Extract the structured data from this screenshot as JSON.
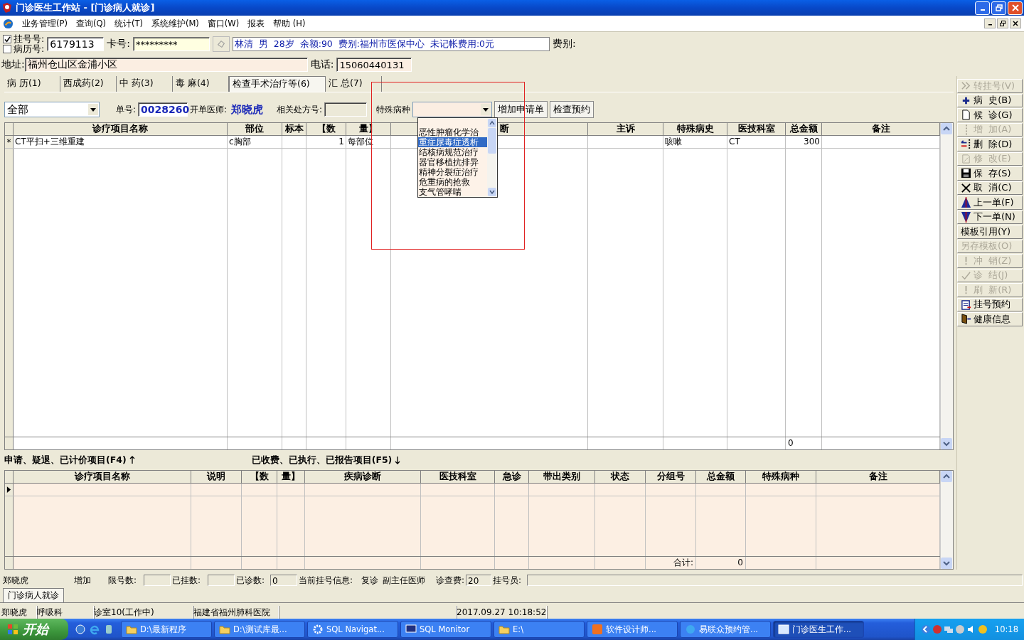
{
  "window": {
    "title": "门诊医生工作站 - [门诊病人就诊]"
  },
  "menu": [
    {
      "label": "业务管理(P)"
    },
    {
      "label": "查询(Q)"
    },
    {
      "label": "统计(T)"
    },
    {
      "label": "系统维护(M)"
    },
    {
      "label": "窗口(W)"
    },
    {
      "label": "报表"
    },
    {
      "label": "帮助 (H)"
    }
  ],
  "patient": {
    "id_options": [
      {
        "label": "挂号号:",
        "checked": true
      },
      {
        "label": "病历号:",
        "checked": false
      }
    ],
    "id_value": "6179113",
    "card_label": "卡号:",
    "card_value": "*********",
    "info": "林清  男  28岁  余额:90  费别:福州市医保中心  未记帐费用:0元",
    "fee_label": "费别:",
    "address_label": "地址:",
    "address_value": "福州仓山区金浦小区",
    "phone_label": "电话:",
    "phone_value": "15060440131"
  },
  "tabs": [
    {
      "label": "病 历(1)",
      "selected": false
    },
    {
      "label": "西成药(2)",
      "selected": false
    },
    {
      "label": "中 药(3)",
      "selected": false
    },
    {
      "label": "毒 麻(4)",
      "selected": false
    },
    {
      "label": "检查手术治疗等(6)",
      "selected": true
    },
    {
      "label": "汇 总(7)",
      "selected": false
    }
  ],
  "toolbar": {
    "filter_value": "全部",
    "order_label": "单号:",
    "order_value": "0028260",
    "doctor_label": "开单医师:",
    "doctor_value": "郑晓虎",
    "related_label": "相关处方号:",
    "disease_label": "特殊病种",
    "buttons": [
      {
        "label": "增加申请单"
      },
      {
        "label": "检查预约"
      }
    ]
  },
  "disease_dropdown": {
    "options": [
      {
        "label": "恶性肿瘤化学治",
        "selected": false
      },
      {
        "label": "重症尿毒症透析",
        "selected": true
      },
      {
        "label": "结核病规范治疗",
        "selected": false
      },
      {
        "label": "器官移植抗排异",
        "selected": false
      },
      {
        "label": "精神分裂症治疗",
        "selected": false
      },
      {
        "label": "危重病的抢救",
        "selected": false
      },
      {
        "label": "支气管哮喘",
        "selected": false
      }
    ]
  },
  "items_grid": {
    "columns": [
      "诊疗项目名称",
      "部位",
      "标本",
      "【数",
      "量】",
      "断",
      "主诉",
      "特殊病史",
      "医技科室",
      "总金额",
      "备注"
    ],
    "rows": [
      {
        "marker": "*",
        "name": "CT平扫+三维重建",
        "site": "c胸部",
        "quantity": "1",
        "unit": "每部位",
        "history": "咳嗽",
        "department": "CT",
        "amount": "300"
      }
    ],
    "footer_total": "0"
  },
  "bottom": {
    "left_label": "申请、疑退、已计价项目(F4)",
    "right_label": "已收费、已执行、已报告项目(F5)",
    "columns": [
      "诊疗项目名称",
      "说明",
      "【数",
      "量】",
      "疾病诊断",
      "医技科室",
      "急诊",
      "带出类别",
      "状态",
      "分组号",
      "总金额",
      "特殊病种",
      "备注"
    ],
    "rows": [
      {
        "current": true
      }
    ],
    "sum_label": "合计:",
    "sum_value": "0"
  },
  "side_buttons": [
    {
      "label": "转挂号(V)",
      "kind": "chevrons",
      "disabled": true
    },
    {
      "label": "病  史(B)",
      "kind": "plus",
      "disabled": false
    },
    {
      "label": "候  诊(G)",
      "kind": "page",
      "disabled": false
    },
    {
      "label": "增  加(A)",
      "kind": "dots",
      "disabled": true
    },
    {
      "label": "删  除(D)",
      "kind": "arrow-left",
      "disabled": false
    },
    {
      "label": "修  改(E)",
      "kind": "edit",
      "disabled": true
    },
    {
      "label": "保  存(S)",
      "kind": "floppy",
      "disabled": false
    },
    {
      "label": "取  消(C)",
      "kind": "cross",
      "disabled": false
    },
    {
      "label": "上一单(F)",
      "kind": "up",
      "disabled": false
    },
    {
      "label": "下一单(N)",
      "kind": "down",
      "disabled": false
    },
    {
      "label": "模板引用(Y)",
      "kind": "none",
      "disabled": false
    },
    {
      "label": "另存模板(O)",
      "kind": "none",
      "disabled": true
    },
    {
      "label": "冲  销(Z)",
      "kind": "exclaim",
      "disabled": true
    },
    {
      "label": "诊  结(J)",
      "kind": "check",
      "disabled": true
    },
    {
      "label": "刷  新(R)",
      "kind": "exclaim",
      "disabled": true
    },
    {
      "label": "挂号预约",
      "kind": "clipboard",
      "disabled": false
    },
    {
      "label": "健康信息",
      "kind": "door",
      "disabled": false
    }
  ],
  "status_bar": [
    {
      "kind": "text",
      "text": "郑晓虎"
    },
    {
      "kind": "text",
      "text": "增加"
    },
    {
      "kind": "text",
      "text": "限号数:"
    },
    {
      "kind": "blank"
    },
    {
      "kind": "text",
      "text": "已挂数:"
    },
    {
      "kind": "blank"
    },
    {
      "kind": "text",
      "text": "已诊数:"
    },
    {
      "kind": "value",
      "text": "0"
    },
    {
      "kind": "text",
      "text": "当前挂号信息:"
    },
    {
      "kind": "text",
      "text": "复诊"
    },
    {
      "kind": "text",
      "text": "副主任医师"
    },
    {
      "kind": "text",
      "text": "诊查费:"
    },
    {
      "kind": "value",
      "text": "20"
    },
    {
      "kind": "text",
      "text": "挂号员:"
    },
    {
      "kind": "blank"
    }
  ],
  "document_tabs": [
    {
      "label": "门诊病人就诊",
      "selected": true
    }
  ],
  "info_bar": [
    {
      "text": "郑晓虎"
    },
    {
      "text": "呼吸科"
    },
    {
      "text": "诊室10(工作中)"
    },
    {
      "text": "福建省福州肺科医院"
    },
    {
      "text": "2017.09.27 10:18:52"
    }
  ],
  "taskbar": {
    "start": "开始",
    "tasks": [
      {
        "label": "D:\\最新程序",
        "kind": "folder",
        "selected": false
      },
      {
        "label": "D:\\测试库最...",
        "kind": "folder",
        "selected": false
      },
      {
        "label": "SQL Navigat...",
        "kind": "gear",
        "selected": false
      },
      {
        "label": "SQL Monitor",
        "kind": "monitor",
        "selected": false
      },
      {
        "label": "E:\\",
        "kind": "folder",
        "selected": false
      },
      {
        "label": "软件设计师...",
        "kind": "g",
        "selected": false
      },
      {
        "label": "易联众预约管...",
        "kind": "browser",
        "selected": false
      },
      {
        "label": "门诊医生工作...",
        "kind": "app",
        "selected": true
      }
    ],
    "clock": "10:18"
  }
}
